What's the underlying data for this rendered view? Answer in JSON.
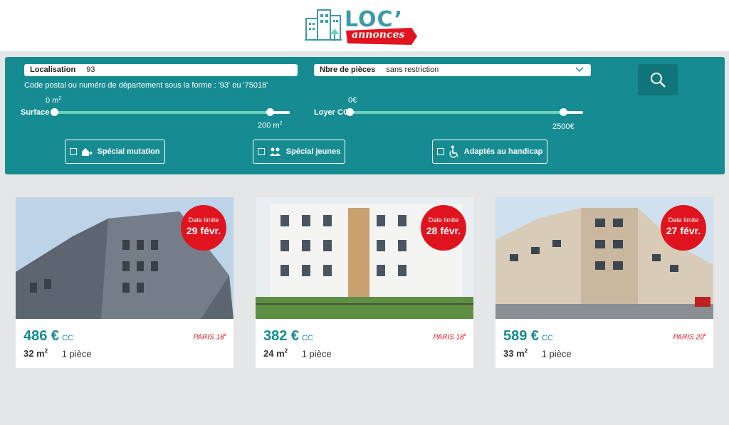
{
  "logo": {
    "title": "LOC’",
    "subtitle": "annonces"
  },
  "filters": {
    "location": {
      "label": "Localisation",
      "value": "93"
    },
    "rooms": {
      "label": "Nbre de pièces",
      "value": "sans restriction"
    },
    "hint": "Code postal ou numéro de département sous la forme : '93' ou '75018'",
    "surface": {
      "label": "Surface",
      "min": "0 m",
      "max": "200 m",
      "unit_exp": "2"
    },
    "rent": {
      "label": "Loyer CC",
      "min": "0€",
      "max": "2500€"
    },
    "toggles": [
      {
        "label": "Spécial mutation",
        "icon": "house-move-icon"
      },
      {
        "label": "Spécial jeunes",
        "icon": "people-icon"
      },
      {
        "label": "Adaptés au handicap",
        "icon": "wheelchair-icon"
      }
    ]
  },
  "listings": [
    {
      "deadline_label": "Date limite",
      "deadline": "29 févr.",
      "price": "486 €",
      "price_suffix": "CC",
      "city": "PARIS 18",
      "city_exp": "e",
      "surface": "32 m",
      "surface_exp": "2",
      "rooms": "1 pièce"
    },
    {
      "deadline_label": "Date limite",
      "deadline": "28 févr.",
      "price": "382 €",
      "price_suffix": "CC",
      "city": "PARIS 18",
      "city_exp": "e",
      "surface": "24 m",
      "surface_exp": "2",
      "rooms": "1 pièce"
    },
    {
      "deadline_label": "Date limite",
      "deadline": "27 févr.",
      "price": "589 €",
      "price_suffix": "CC",
      "city": "PARIS 20",
      "city_exp": "e",
      "surface": "33 m",
      "surface_exp": "2",
      "rooms": "1 pièce"
    }
  ],
  "colors": {
    "teal": "#168c92",
    "accent_red": "#e0141e",
    "logo_teal": "#3d9aa6"
  }
}
